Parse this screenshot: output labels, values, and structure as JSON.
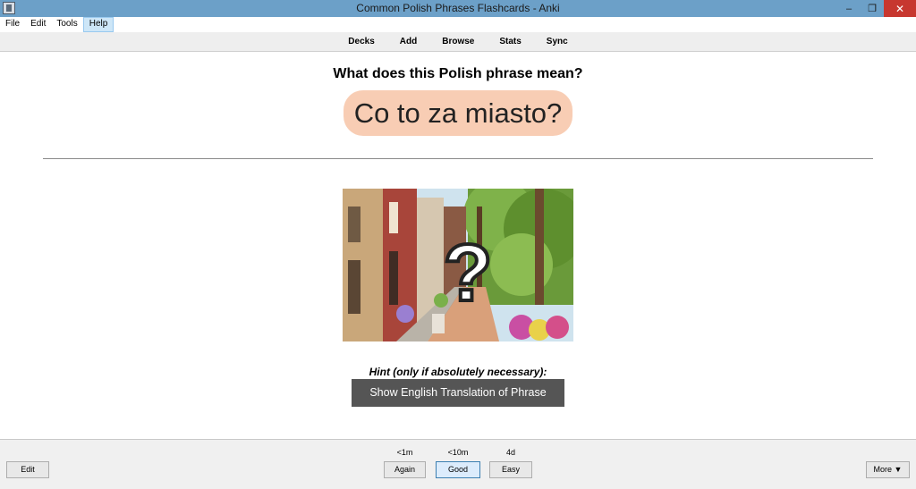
{
  "window": {
    "title": "Common Polish Phrases Flashcards - Anki",
    "minimize_icon": "minimize-icon",
    "maximize_icon": "restore-icon",
    "close_icon": "close-icon",
    "minimize_glyph": "–",
    "maximize_glyph": "❐",
    "close_glyph": "✕"
  },
  "menu": {
    "items": [
      {
        "label": "File"
      },
      {
        "label": "Edit"
      },
      {
        "label": "Tools"
      },
      {
        "label": "Help",
        "active": true
      }
    ]
  },
  "toolbar": {
    "links": [
      {
        "label": "Decks"
      },
      {
        "label": "Add"
      },
      {
        "label": "Browse"
      },
      {
        "label": "Stats"
      },
      {
        "label": "Sync"
      }
    ]
  },
  "card": {
    "question": "What does this Polish phrase mean?",
    "phrase": "Co to za miasto?",
    "phrase_bg": "#f8cdb4",
    "image": "street-scene-with-question-mark",
    "image_overlay": "?",
    "hint_label": "Hint (only if absolutely necessary):",
    "hint_button": "Show English Translation of Phrase"
  },
  "bottom": {
    "edit_label": "Edit",
    "answers": [
      {
        "label": "Again",
        "interval": "<1m"
      },
      {
        "label": "Good",
        "interval": "<10m",
        "default": true
      },
      {
        "label": "Easy",
        "interval": "4d"
      }
    ],
    "more_label": "More ▼"
  }
}
